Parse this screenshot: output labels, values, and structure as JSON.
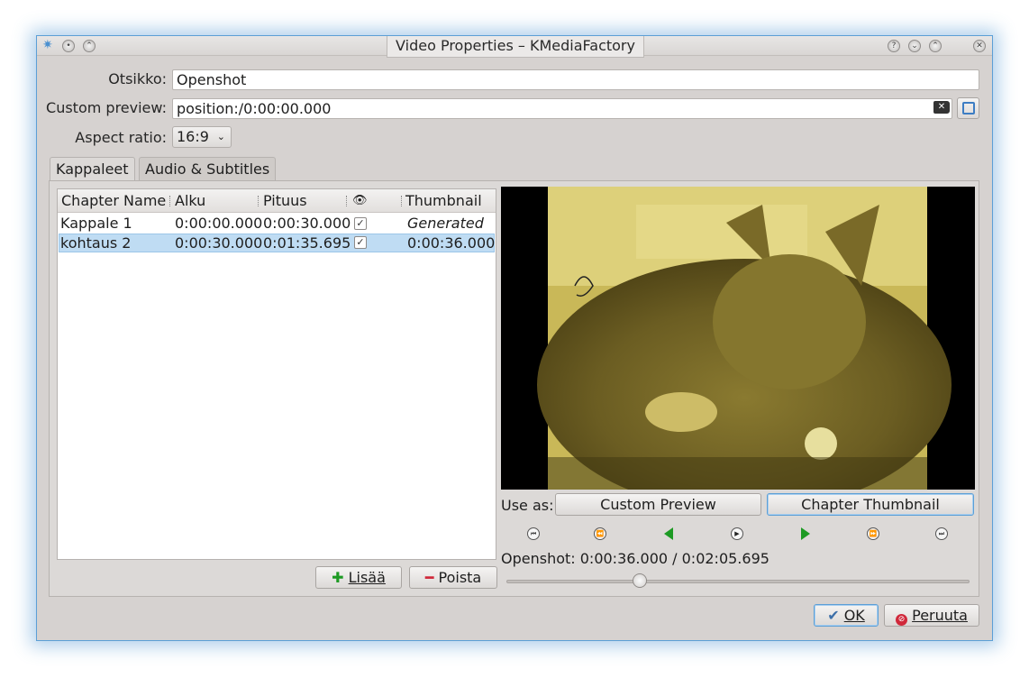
{
  "window": {
    "title": "Video Properties – KMediaFactory",
    "buttons": [
      "help-icon",
      "minimize-icon",
      "maximize-icon",
      "close-icon"
    ]
  },
  "form": {
    "title_label": "Otsikko:",
    "title_value": "Openshot",
    "custom_preview_label": "Custom preview:",
    "custom_preview_value": "position:/0:00:00.000",
    "aspect_label": "Aspect ratio:",
    "aspect_value": "16:9"
  },
  "tabs": [
    {
      "label": "Kappaleet",
      "active": true
    },
    {
      "label": "Audio & Subtitles",
      "active": false
    }
  ],
  "chapters": {
    "columns": [
      "Chapter Name",
      "Alku",
      "Pituus",
      "eye-icon",
      "Thumbnail"
    ],
    "rows": [
      {
        "name": "Kappale 1",
        "start": "0:00:00.000",
        "length": "0:00:30.000",
        "visible": true,
        "thumbnail": "Generated"
      },
      {
        "name": "kohtaus 2",
        "start": "0:00:30.000",
        "length": "0:01:35.695",
        "visible": true,
        "thumbnail": "0:00:36.000"
      }
    ],
    "add_label": "Lisää",
    "remove_label": "Poista"
  },
  "preview": {
    "use_as_label": "Use as:",
    "custom_preview_btn": "Custom Preview",
    "chapter_thumbnail_btn": "Chapter Thumbnail",
    "status": "Openshot: 0:00:36.000 / 0:02:05.695",
    "position_fraction": 0.288
  },
  "dialog": {
    "ok_label": "OK",
    "cancel_label": "Peruuta"
  },
  "colors": {
    "accent": "#5c9fd6",
    "selection": "#bfdcf3",
    "play_green": "#1d9a23",
    "remove_red": "#d0283a"
  }
}
